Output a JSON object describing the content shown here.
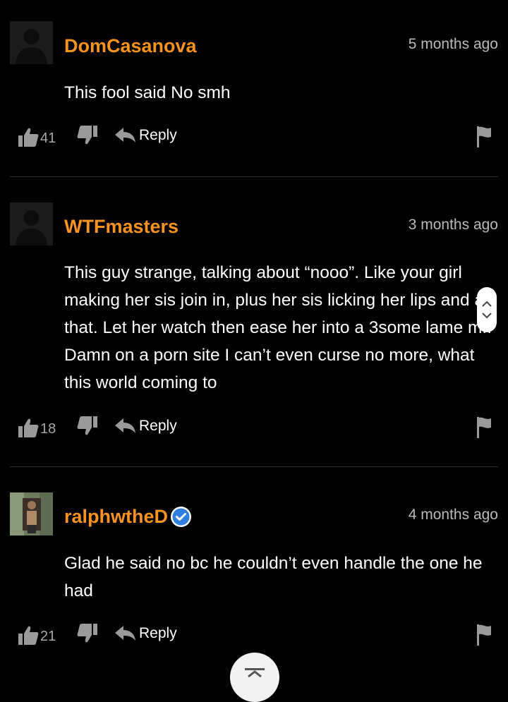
{
  "comments": [
    {
      "username": "DomCasanova",
      "time": "5 months ago",
      "text": "This fool said No smh",
      "likes": "41",
      "reply": "Reply",
      "avatar": "default-avatar-icon"
    },
    {
      "username": "WTFmasters",
      "time": "3 months ago",
      "text": "This guy strange, talking about “nooo”. Like your girl making her sis join in, plus her sis licking her lips and all that. Let her watch then ease her into a 3some lame mf. Damn on a porn site I can’t even curse no more, what this world coming to",
      "likes": "18",
      "reply": "Reply",
      "avatar": "default-avatar-icon"
    },
    {
      "username": "ralphwtheD",
      "time": "4 months ago",
      "text": "Glad he said no bc he couldn’t even handle the one he had",
      "likes": "21",
      "reply": "Reply",
      "avatar": "photo-avatar",
      "verified": true
    }
  ],
  "colors": {
    "background": "#000000",
    "username": "#f7931e",
    "verified": "#2f7fe0",
    "muted": "#b9b9b9"
  }
}
